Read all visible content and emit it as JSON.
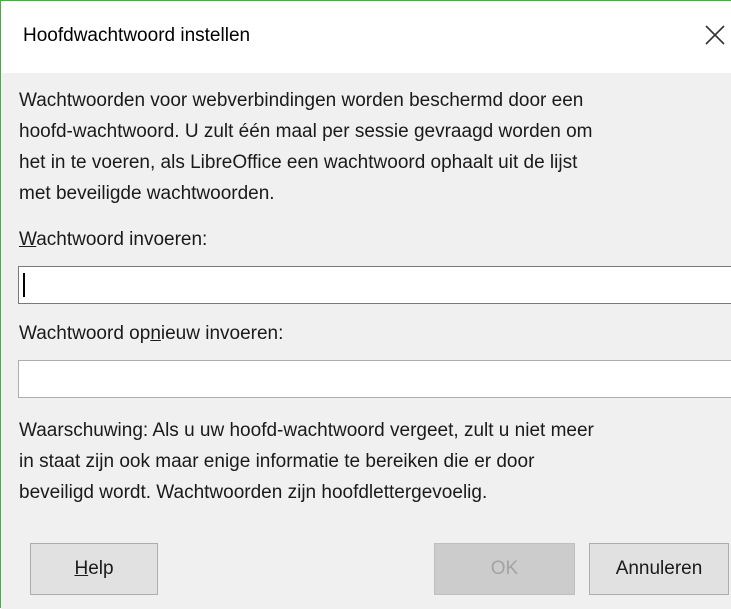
{
  "dialog": {
    "title": "Hoofdwachtwoord instellen",
    "close_icon": "close-icon",
    "description": "Wachtwoorden voor webverbindingen worden beschermd door een\nhoofd-wachtwoord. U zult één maal per sessie gevraagd worden om\nhet in te voeren, als LibreOffice een wachtwoord ophaalt uit de lijst\nmet beveiligde wachtwoorden.",
    "password_label": {
      "before": "",
      "mnemonic": "W",
      "after": "achtwoord invoeren:"
    },
    "password_value": "",
    "confirm_label": {
      "before": "Wachtwoord op",
      "mnemonic": "n",
      "after": "ieuw invoeren:"
    },
    "confirm_value": "",
    "warning": "Waarschuwing: Als u uw hoofd-wachtwoord vergeet, zult u niet meer\nin staat zijn ook maar enige informatie te bereiken die er door\nbeveiligd wordt. Wachtwoorden zijn hoofdlettergevoelig.",
    "buttons": {
      "help": {
        "mnemonic": "H",
        "rest": "elp"
      },
      "ok": "OK",
      "cancel": "Annuleren"
    }
  }
}
